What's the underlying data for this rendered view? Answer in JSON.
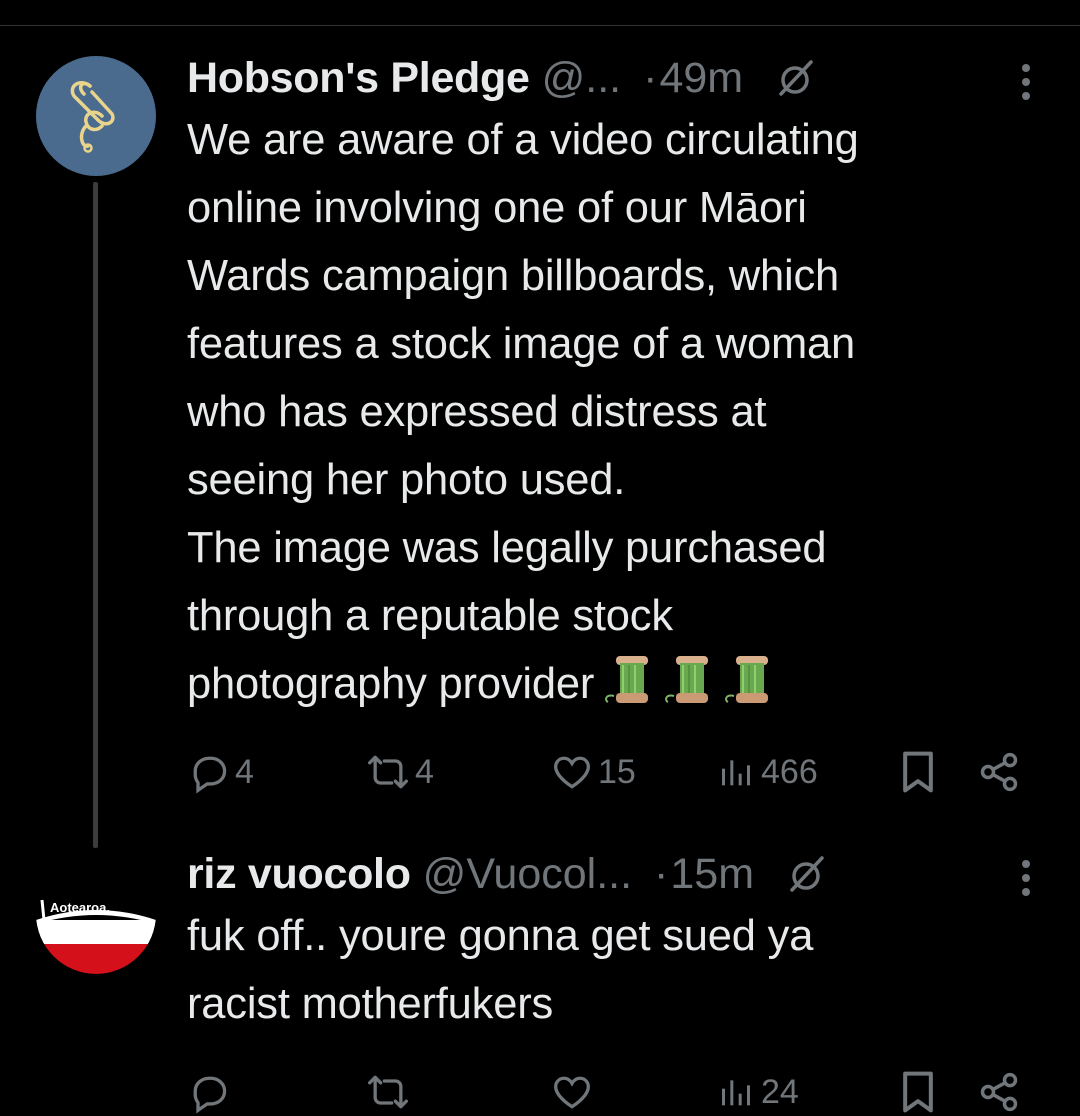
{
  "tweets": [
    {
      "display_name": "Hobson's Pledge",
      "handle": "@...",
      "separator": "·",
      "time": "49m",
      "lines": [
        "We are aware of a video circulating",
        "online involving one of our Māori",
        "Wards campaign billboards, which",
        "features a stock image of a woman",
        "who has expressed distress at",
        "seeing her photo used.",
        "The image was legally purchased",
        "through a reputable stock",
        "photography provider"
      ],
      "emoji": "thread-spool-emoji x3",
      "replies": "4",
      "reposts": "4",
      "likes": "15",
      "views": "466",
      "avatar_icon": "paperclip-logo-icon",
      "avatar_color": "#4b6b8e"
    },
    {
      "display_name": "riz vuocolo",
      "handle": "@Vuocol...",
      "separator": "·",
      "time": "15m",
      "lines": [
        "fuk off.. youre gonna get sued ya",
        "racist motherfukers"
      ],
      "replies": "",
      "reposts": "",
      "likes": "",
      "views": "24",
      "avatar_label": "Aotearoa.",
      "avatar_icon": "tino-rangatiratanga-flag-icon"
    }
  ],
  "colors": {
    "background": "#000000",
    "text": "#e7e9ea",
    "secondary": "#71767b",
    "thread_line": "#3a3d40"
  }
}
